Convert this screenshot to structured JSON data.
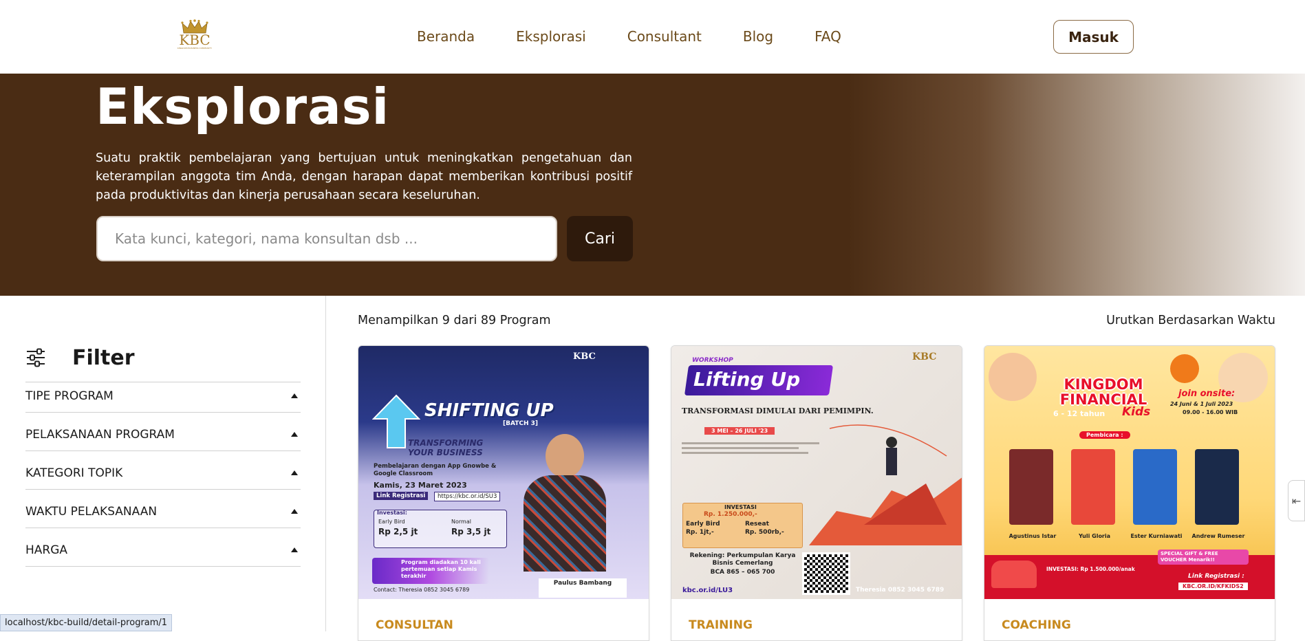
{
  "brand": {
    "logo_text": "KBC",
    "logo_sub": "KINGDOM BUSINESS COMMUNITY"
  },
  "nav": {
    "items": [
      "Beranda",
      "Eksplorasi",
      "Consultant",
      "Blog",
      "FAQ"
    ],
    "login_label": "Masuk"
  },
  "hero": {
    "title": "Eksplorasi",
    "description": "Suatu praktik pembelajaran yang bertujuan untuk meningkatkan pengetahuan dan keterampilan anggota tim Anda, dengan harapan dapat memberikan kontribusi positif pada produktivitas dan kinerja perusahaan secara keseluruhan.",
    "search_placeholder": "Kata kunci, kategori, nama konsultan dsb ...",
    "search_button": "Cari"
  },
  "filter": {
    "title": "Filter",
    "sections": [
      "TIPE PROGRAM",
      "PELAKSANAAN PROGRAM",
      "KATEGORI TOPIK",
      "WAKTU PELAKSANAAN",
      "HARGA"
    ]
  },
  "results": {
    "count_text": "Menampilkan 9 dari 89 Program",
    "sort_label": "Urutkan Berdasarkan Waktu"
  },
  "cards": [
    {
      "category": "CONSULTAN",
      "poster": {
        "headline": "SHIFTING UP",
        "batch": "[BATCH 3]",
        "tagline": "TRANSFORMING YOUR BUSINESS",
        "line1": "Pembelajaran dengan App Gnowbe & Google Classroom",
        "date": "Kamis, 23 Maret 2023",
        "reg_label": "Link Registrasi",
        "reg_link": "https://kbc.or.id/SU3",
        "invest_label": "Investasi:",
        "early_bird": "Early Bird",
        "early_price": "Rp 2,5 jt",
        "normal": "Normal",
        "normal_price": "Rp 3,5 jt",
        "program_note": "Program diadakan 10 kali pertemuan setiap Kamis terakhir",
        "speaker": "Paulus Bambang",
        "contact": "Contact: Theresia 0852 3045 6789"
      }
    },
    {
      "category": "TRAINING",
      "poster": {
        "workshop": "WORKSHOP",
        "headline": "Lifting Up",
        "sub": "TRANSFORMASI DIMULAI DARI PEMIMPIN.",
        "dates": "3 MEI – 26 JULI '23",
        "investasi": "INVESTASI",
        "price": "Rp. 1.250.000,-",
        "early": "Early Bird",
        "early_price": "Rp. 1jt,-",
        "reseat": "Reseat",
        "reseat_price": "Rp. 500rb,-",
        "account": "Rekening: Perkumpulan Karya Bisnis Cemerlang",
        "bank": "BCA 865 – 065 700",
        "link": "kbc.or.id/LU3",
        "contact": "Theresia 0852 3045 6789"
      }
    },
    {
      "category": "COACHING",
      "poster": {
        "headline": "KINGDOM FINANCIAL",
        "age": "6 - 12 tahun",
        "kids": "Kids",
        "join": "join onsite:",
        "dates": "24 Juni & 1 Juli 2023",
        "time": "09.00 - 16.00 WIB",
        "speakers_label": "Pembicara :",
        "speakers": [
          "Agustinus Istar",
          "Yuli Gloria",
          "Ester Kurniawati",
          "Andrew Rumeser"
        ],
        "invest": "INVESTASI: Rp 1.500.000/anak",
        "gift": "SPECIAL GIFT & FREE VOUCHER Menarik!!",
        "reg_label": "Link Registrasi :",
        "reg_link": "KBC.OR.ID/KFKIDS2"
      }
    }
  ],
  "status_bar": {
    "url": "localhost/kbc-build/detail-program/1"
  },
  "colors": {
    "brand_brown": "#4a2c14",
    "accent_gold": "#c88a1e",
    "nav_text": "#6b4a1a"
  }
}
